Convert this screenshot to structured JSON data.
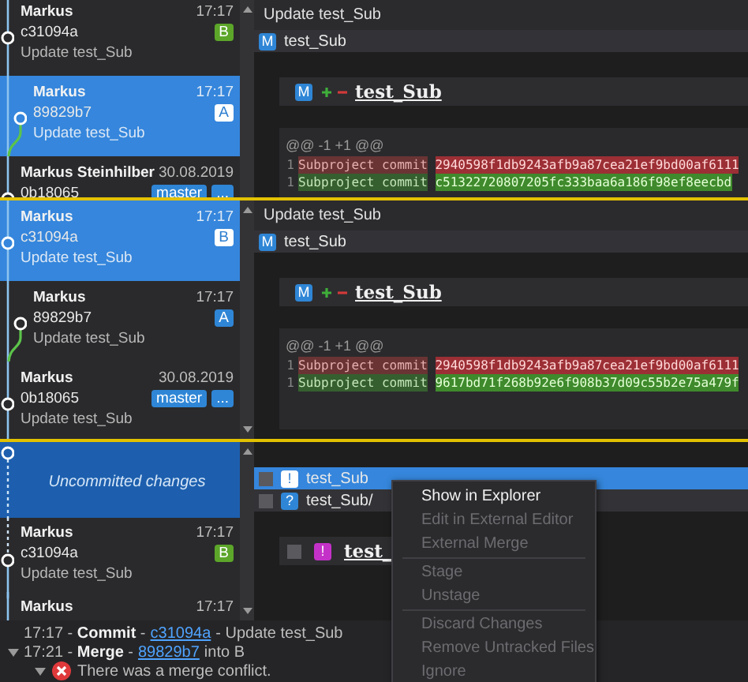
{
  "panels": [
    {
      "commits": [
        {
          "kind": "commit",
          "author": "Markus",
          "time": "17:17",
          "hash": "c31094a",
          "message": "Update test_Sub",
          "branch": false,
          "selected": false,
          "refs": [
            {
              "label": "B",
              "color": "#5ca62a"
            }
          ]
        },
        {
          "kind": "commit",
          "author": "Markus",
          "time": "17:17",
          "hash": "89829b7",
          "message": "Update test_Sub",
          "branch": true,
          "selected": true,
          "refs": [
            {
              "label": "A",
              "color": "#ffffff"
            }
          ]
        },
        {
          "kind": "commit",
          "author": "Markus Steinhilber",
          "time": "30.08.2019",
          "hash": "0b18065",
          "branch": false,
          "selected": false,
          "refs": [
            {
              "label": "master",
              "color": "#2f86d6"
            },
            {
              "label": "...",
              "color": "#2f86d6"
            }
          ]
        }
      ],
      "detail": {
        "title": "Update test_Sub",
        "files": [
          {
            "status": "M",
            "color": "#2f86d6",
            "name": "test_Sub"
          }
        ],
        "diff": {
          "status": "M",
          "color": "#2f86d6",
          "name": "test_Sub",
          "hunk": "@@ -1 +1 @@",
          "lines": [
            {
              "kind": "removed",
              "number": "1",
              "text": "Subproject commit",
              "hash": "2940598f1db9243afb9a87cea21ef9bd00af6111"
            },
            {
              "kind": "added",
              "number": "1",
              "text": "Subproject commit",
              "hash": "c51322720807205fc333baa6a186f98ef8eecbd"
            }
          ]
        }
      }
    },
    {
      "commits": [
        {
          "kind": "commit",
          "author": "Markus",
          "time": "17:17",
          "hash": "c31094a",
          "message": "Update test_Sub",
          "branch": false,
          "selected": true,
          "refs": [
            {
              "label": "B",
              "color": "#ffffff"
            }
          ]
        },
        {
          "kind": "commit",
          "author": "Markus",
          "time": "17:17",
          "hash": "89829b7",
          "message": "Update test_Sub",
          "branch": true,
          "selected": false,
          "refs": [
            {
              "label": "A",
              "color": "#2f86d6"
            }
          ]
        },
        {
          "kind": "commit",
          "author": "Markus",
          "time": "30.08.2019",
          "hash": "0b18065",
          "message": "Update test_Sub",
          "branch": false,
          "selected": false,
          "refs": [
            {
              "label": "master",
              "color": "#2f86d6"
            },
            {
              "label": "...",
              "color": "#2f86d6"
            }
          ]
        }
      ],
      "detail": {
        "title": "Update test_Sub",
        "files": [
          {
            "status": "M",
            "color": "#2f86d6",
            "name": "test_Sub"
          }
        ],
        "diff": {
          "status": "M",
          "color": "#2f86d6",
          "name": "test_Sub",
          "hunk": "@@ -1 +1 @@",
          "lines": [
            {
              "kind": "removed",
              "number": "1",
              "text": "Subproject commit",
              "hash": "2940598f1db9243afb9a87cea21ef9bd00af6111"
            },
            {
              "kind": "added",
              "number": "1",
              "text": "Subproject commit",
              "hash": "9617bd71f268b92e6f908b37d09c55b2e75a479f"
            }
          ]
        }
      }
    },
    {
      "commits": [
        {
          "kind": "uncommitted",
          "message": "Uncommitted changes",
          "selected": true
        },
        {
          "kind": "commit",
          "author": "Markus",
          "time": "17:17",
          "hash": "c31094a",
          "message": "Update test_Sub",
          "branch": false,
          "selected": false,
          "refs": [
            {
              "label": "B",
              "color": "#5ca62a"
            }
          ]
        },
        {
          "kind": "commit",
          "author": "Markus",
          "time": "17:17",
          "branch": false,
          "selected": false
        }
      ],
      "detail": {
        "files": [
          {
            "status": "!",
            "color": "#ffffff",
            "name": "test_Sub",
            "checked": false,
            "selected": true
          },
          {
            "status": "?",
            "color": "#2f86d6",
            "name": "test_Sub/",
            "checked": false,
            "selected": false
          }
        ],
        "diff": {
          "status": "!",
          "color": "#c431c8",
          "name": "test_",
          "checked": false
        }
      }
    }
  ],
  "context_menu": [
    {
      "kind": "item",
      "label": "Show in Explorer",
      "disabled": false
    },
    {
      "kind": "item",
      "label": "Edit in External Editor",
      "disabled": true
    },
    {
      "kind": "item",
      "label": "External Merge",
      "disabled": true
    },
    {
      "kind": "separator"
    },
    {
      "kind": "item",
      "label": "Stage",
      "disabled": true
    },
    {
      "kind": "item",
      "label": "Unstage",
      "disabled": true
    },
    {
      "kind": "separator"
    },
    {
      "kind": "item",
      "label": "Discard Changes",
      "disabled": true
    },
    {
      "kind": "item",
      "label": "Remove Untracked Files",
      "disabled": true
    },
    {
      "kind": "item",
      "label": "Ignore",
      "disabled": true
    }
  ],
  "log": [
    {
      "prefix": "17:17 - **Commit** -",
      "commit": "c31094a",
      "suffix": "- Update test_Sub"
    },
    {
      "prefix": "17:21 - **Merge** -",
      "commit": "89829b7",
      "suffix": "into B",
      "expanded": true,
      "children": [
        {
          "kind": "error",
          "text": "There was a merge conflict.",
          "expanded": true
        }
      ]
    }
  ]
}
